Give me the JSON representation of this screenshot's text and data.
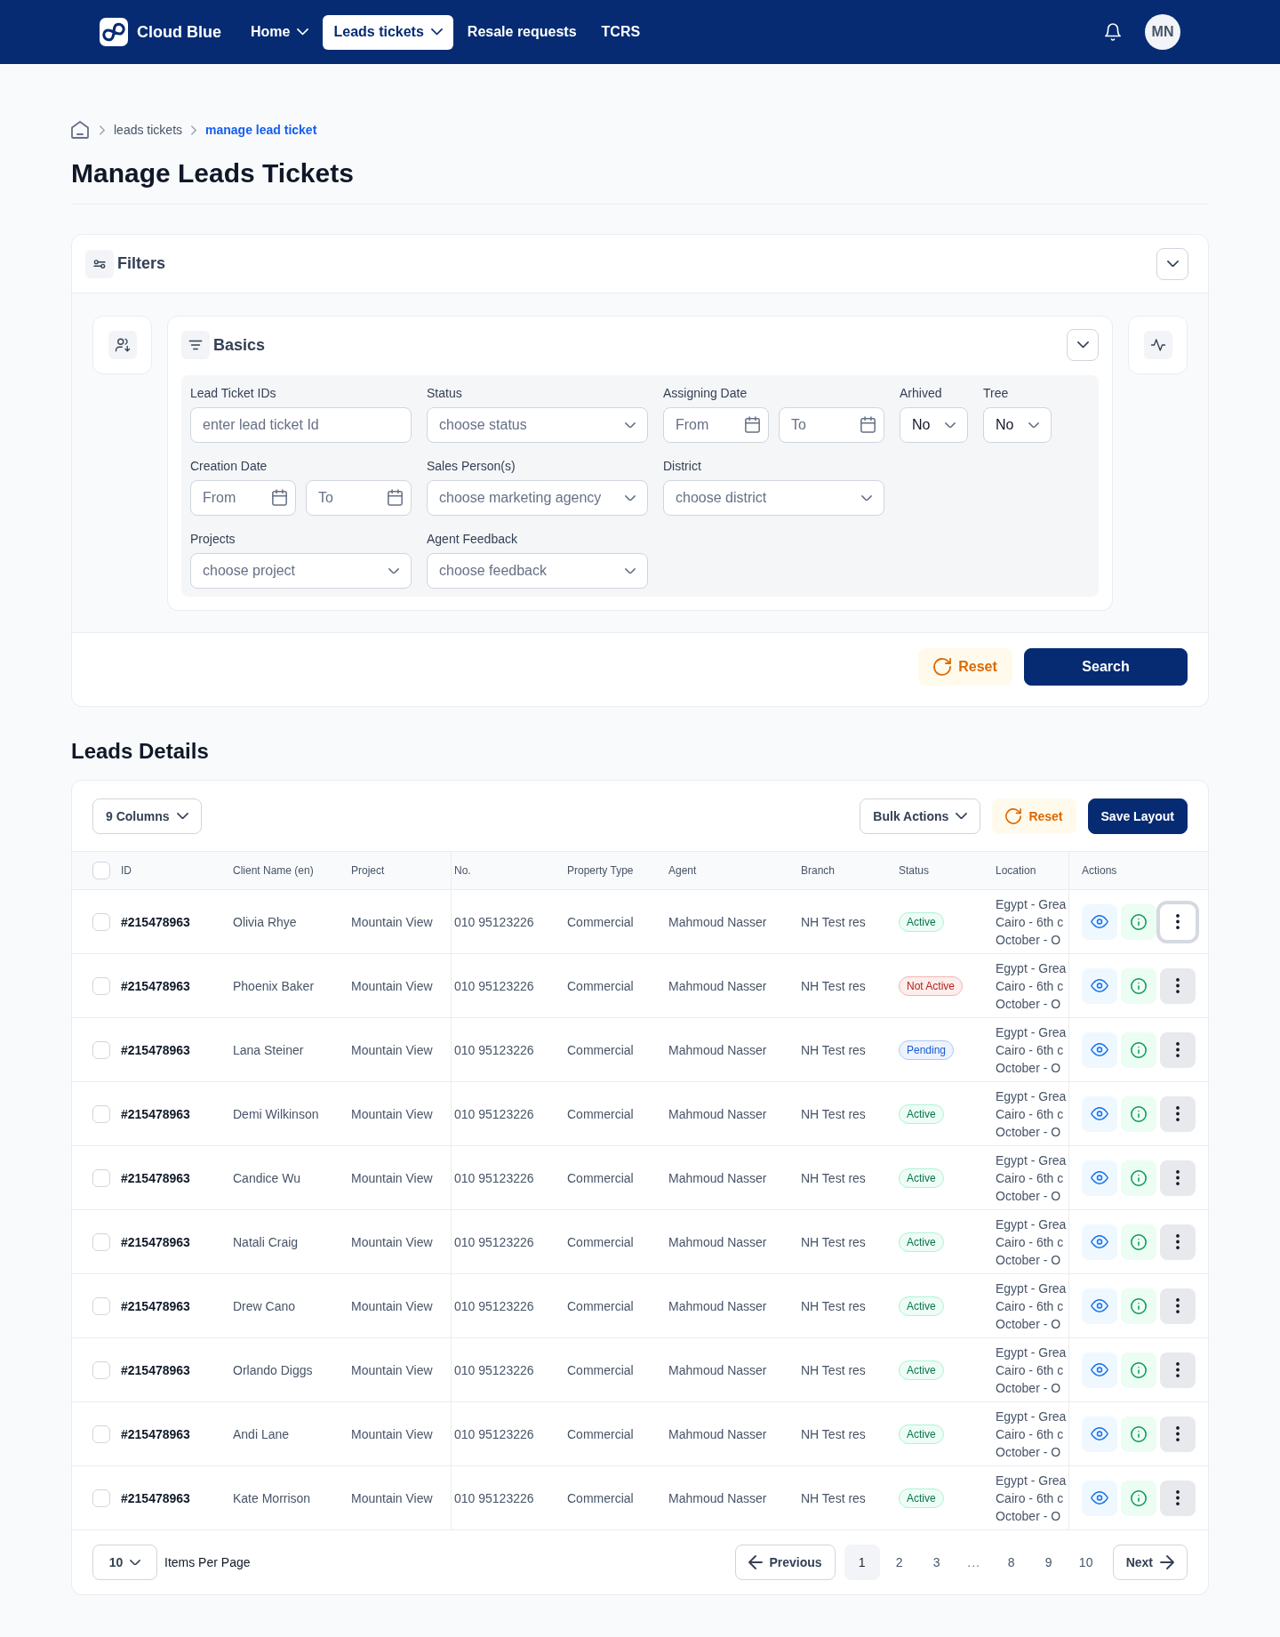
{
  "nav": {
    "brand": "Cloud Blue",
    "items": [
      {
        "label": "Home",
        "dropdown": true,
        "selected": false
      },
      {
        "label": "Leads tickets",
        "dropdown": true,
        "selected": true
      },
      {
        "label": "Resale requests",
        "dropdown": false,
        "selected": false
      },
      {
        "label": "TCRS",
        "dropdown": false,
        "selected": false
      }
    ],
    "avatar": "MN"
  },
  "breadcrumb": [
    {
      "label": "leads tickets",
      "current": false
    },
    {
      "label": "manage lead ticket",
      "current": true
    }
  ],
  "title": "Manage Leads Tickets",
  "filters": {
    "title": "Filters",
    "basics": {
      "title": "Basics",
      "rows": [
        [
          {
            "label": "Lead Ticket IDs",
            "kind": "text",
            "placeholder": "enter lead ticket Id"
          },
          {
            "label": "Status",
            "kind": "select",
            "placeholder": "choose status"
          },
          {
            "label": "Assigning Date",
            "kind": "date_range",
            "inputs": [
              {
                "placeholder": "From"
              },
              {
                "placeholder": "To"
              }
            ]
          },
          {
            "label": "Arhived",
            "kind": "short_select",
            "value": "No"
          },
          {
            "label": "Tree",
            "kind": "short_select",
            "value": "No"
          }
        ],
        [
          {
            "label": "Creation Date",
            "kind": "date_range",
            "inputs": [
              {
                "placeholder": "From"
              },
              {
                "placeholder": "To"
              }
            ]
          },
          {
            "label": "Sales Person(s)",
            "kind": "select",
            "placeholder": "choose marketing agency"
          },
          {
            "label": "District",
            "kind": "select",
            "placeholder": "choose district"
          }
        ],
        [
          {
            "label": "Projects",
            "kind": "select",
            "placeholder": "choose project"
          },
          {
            "label": "Agent Feedback",
            "kind": "select",
            "placeholder": "choose feedback"
          }
        ]
      ]
    },
    "reset": "Reset",
    "search": "Search"
  },
  "leads": {
    "title": "Leads Details",
    "toolbar": {
      "columns": "9 Columns",
      "bulk_actions": "Bulk Actions",
      "reset": "Reset",
      "save_layout": "Save Layout"
    },
    "table": {
      "all_checked": false,
      "columns": [
        "ID",
        "Client Name (en)",
        "Project",
        "No.",
        "Property Type",
        "Agent",
        "Branch",
        "Status",
        "Location",
        "Actions"
      ],
      "rows": [
        {
          "checked": false,
          "id": "#215478963",
          "client": "Olivia Rhye",
          "project": "Mountain View",
          "number": "010 95123226",
          "property_type": "Commercial",
          "agent": "Mahmoud Nasser",
          "branch": "NH Test res",
          "status": {
            "label": "Active",
            "color": "#067647"
          },
          "location": "Egypt - Grea\nCairo - 6th c\nOctober - O",
          "menu_focused": true
        },
        {
          "checked": false,
          "id": "#215478963",
          "client": "Phoenix Baker",
          "project": "Mountain View",
          "number": "010 95123226",
          "property_type": "Commercial",
          "agent": "Mahmoud Nasser",
          "branch": "NH Test res",
          "status": {
            "label": "Not Active",
            "color": "#b42318"
          },
          "location": "Egypt - Grea\nCairo - 6th c\nOctober - O",
          "menu_focused": false
        },
        {
          "checked": false,
          "id": "#215478963",
          "client": "Lana Steiner",
          "project": "Mountain View",
          "number": "010 95123226",
          "property_type": "Commercial",
          "agent": "Mahmoud Nasser",
          "branch": "NH Test res",
          "status": {
            "label": "Pending",
            "color": "#175cd3"
          },
          "location": "Egypt - Grea\nCairo - 6th c\nOctober - O",
          "menu_focused": false
        },
        {
          "checked": false,
          "id": "#215478963",
          "client": "Demi Wilkinson",
          "project": "Mountain View",
          "number": "010 95123226",
          "property_type": "Commercial",
          "agent": "Mahmoud Nasser",
          "branch": "NH Test res",
          "status": {
            "label": "Active",
            "color": "#067647"
          },
          "location": "Egypt - Grea\nCairo - 6th c\nOctober - O",
          "menu_focused": false
        },
        {
          "checked": false,
          "id": "#215478963",
          "client": "Candice Wu",
          "project": "Mountain View",
          "number": "010 95123226",
          "property_type": "Commercial",
          "agent": "Mahmoud Nasser",
          "branch": "NH Test res",
          "status": {
            "label": "Active",
            "color": "#067647"
          },
          "location": "Egypt - Grea\nCairo - 6th c\nOctober - O",
          "menu_focused": false
        },
        {
          "checked": false,
          "id": "#215478963",
          "client": "Natali Craig",
          "project": "Mountain View",
          "number": "010 95123226",
          "property_type": "Commercial",
          "agent": "Mahmoud Nasser",
          "branch": "NH Test res",
          "status": {
            "label": "Active",
            "color": "#067647"
          },
          "location": "Egypt - Grea\nCairo - 6th c\nOctober - O",
          "menu_focused": false
        },
        {
          "checked": false,
          "id": "#215478963",
          "client": "Drew Cano",
          "project": "Mountain View",
          "number": "010 95123226",
          "property_type": "Commercial",
          "agent": "Mahmoud Nasser",
          "branch": "NH Test res",
          "status": {
            "label": "Active",
            "color": "#067647"
          },
          "location": "Egypt - Grea\nCairo - 6th c\nOctober - O",
          "menu_focused": false
        },
        {
          "checked": false,
          "id": "#215478963",
          "client": "Orlando Diggs",
          "project": "Mountain View",
          "number": "010 95123226",
          "property_type": "Commercial",
          "agent": "Mahmoud Nasser",
          "branch": "NH Test res",
          "status": {
            "label": "Active",
            "color": "#067647"
          },
          "location": "Egypt - Grea\nCairo - 6th c\nOctober - O",
          "menu_focused": false
        },
        {
          "checked": false,
          "id": "#215478963",
          "client": "Andi Lane",
          "project": "Mountain View",
          "number": "010 95123226",
          "property_type": "Commercial",
          "agent": "Mahmoud Nasser",
          "branch": "NH Test res",
          "status": {
            "label": "Active",
            "color": "#067647"
          },
          "location": "Egypt - Grea\nCairo - 6th c\nOctober - O",
          "menu_focused": false
        },
        {
          "checked": false,
          "id": "#215478963",
          "client": "Kate Morrison",
          "project": "Mountain View",
          "number": "010 95123226",
          "property_type": "Commercial",
          "agent": "Mahmoud Nasser",
          "branch": "NH Test res",
          "status": {
            "label": "Active",
            "color": "#067647"
          },
          "location": "Egypt - Grea\nCairo - 6th c\nOctober - O",
          "menu_focused": false
        }
      ]
    },
    "pagination": {
      "per_page": "10",
      "per_page_label": "Items Per Page",
      "previous": "Previous",
      "next": "Next",
      "pages": [
        {
          "label": "1",
          "kind": "page",
          "selected": true
        },
        {
          "label": "2",
          "kind": "page",
          "selected": false
        },
        {
          "label": "3",
          "kind": "page",
          "selected": false
        },
        {
          "label": "...",
          "kind": "gap"
        },
        {
          "label": "8",
          "kind": "page",
          "selected": false
        },
        {
          "label": "9",
          "kind": "page",
          "selected": false
        },
        {
          "label": "10",
          "kind": "page",
          "selected": false
        }
      ]
    }
  }
}
